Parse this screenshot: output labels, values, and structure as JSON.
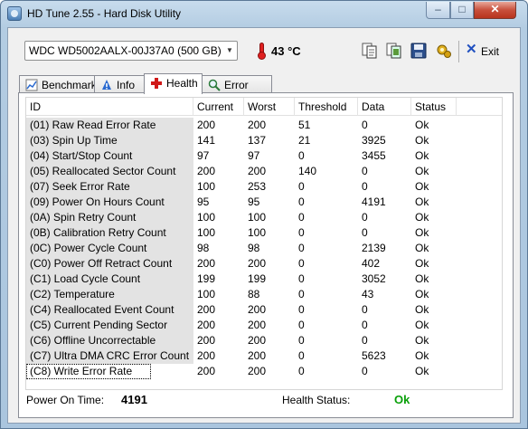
{
  "window": {
    "title": "HD Tune 2.55 - Hard Disk Utility",
    "minimize_glyph": "–",
    "maximize_glyph": "□",
    "close_glyph": "✕"
  },
  "toolbar": {
    "drive": "WDC WD5002AALX-00J37A0 (500 GB)",
    "temperature": "43 °C",
    "exit_label": "Exit",
    "icons": [
      "copy-text-icon",
      "copy-screenshot-icon",
      "save-icon",
      "options-icon",
      "exit-icon"
    ]
  },
  "tabs": [
    {
      "label": "Benchmark",
      "icon": "benchmark-icon",
      "active": false
    },
    {
      "label": "Info",
      "icon": "info-icon",
      "active": false
    },
    {
      "label": "Health",
      "icon": "health-cross-icon",
      "active": true
    },
    {
      "label": "Error Scan",
      "icon": "magnifier-icon",
      "active": false
    }
  ],
  "table": {
    "columns": [
      "ID",
      "Current",
      "Worst",
      "Threshold",
      "Data",
      "Status"
    ],
    "rows": [
      [
        "(01) Raw Read Error Rate",
        "200",
        "200",
        "51",
        "0",
        "Ok"
      ],
      [
        "(03) Spin Up Time",
        "141",
        "137",
        "21",
        "3925",
        "Ok"
      ],
      [
        "(04) Start/Stop Count",
        "97",
        "97",
        "0",
        "3455",
        "Ok"
      ],
      [
        "(05) Reallocated Sector Count",
        "200",
        "200",
        "140",
        "0",
        "Ok"
      ],
      [
        "(07) Seek Error Rate",
        "100",
        "253",
        "0",
        "0",
        "Ok"
      ],
      [
        "(09) Power On Hours Count",
        "95",
        "95",
        "0",
        "4191",
        "Ok"
      ],
      [
        "(0A) Spin Retry Count",
        "100",
        "100",
        "0",
        "0",
        "Ok"
      ],
      [
        "(0B) Calibration Retry Count",
        "100",
        "100",
        "0",
        "0",
        "Ok"
      ],
      [
        "(0C) Power Cycle Count",
        "98",
        "98",
        "0",
        "2139",
        "Ok"
      ],
      [
        "(C0) Power Off Retract Count",
        "200",
        "200",
        "0",
        "402",
        "Ok"
      ],
      [
        "(C1) Load Cycle Count",
        "199",
        "199",
        "0",
        "3052",
        "Ok"
      ],
      [
        "(C2) Temperature",
        "100",
        "88",
        "0",
        "43",
        "Ok"
      ],
      [
        "(C4) Reallocated Event Count",
        "200",
        "200",
        "0",
        "0",
        "Ok"
      ],
      [
        "(C5) Current Pending Sector",
        "200",
        "200",
        "0",
        "0",
        "Ok"
      ],
      [
        "(C6) Offline Uncorrectable",
        "200",
        "200",
        "0",
        "0",
        "Ok"
      ],
      [
        "(C7) Ultra DMA CRC Error Count",
        "200",
        "200",
        "0",
        "5623",
        "Ok"
      ],
      [
        "(C8) Write Error Rate",
        "200",
        "200",
        "0",
        "0",
        "Ok"
      ]
    ]
  },
  "footer": {
    "power_on_label": "Power On Time:",
    "power_on_value": "4191",
    "health_label": "Health Status:",
    "health_value": "Ok",
    "health_color": "#0aa00a"
  }
}
